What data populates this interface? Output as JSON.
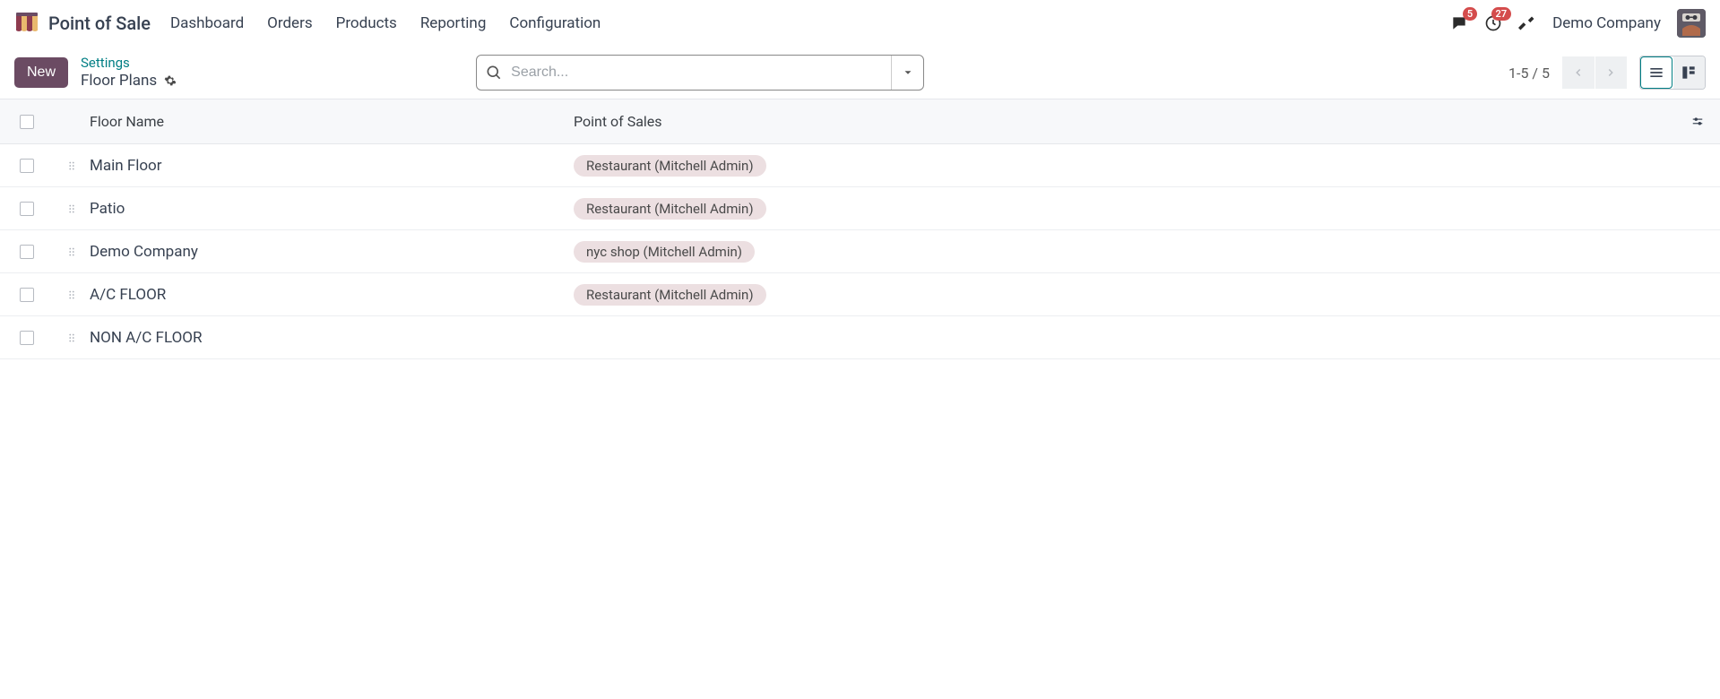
{
  "nav": {
    "app_title": "Point of Sale",
    "menu": [
      "Dashboard",
      "Orders",
      "Products",
      "Reporting",
      "Configuration"
    ],
    "messages_badge": "5",
    "activities_badge": "27",
    "company": "Demo Company"
  },
  "control": {
    "new_label": "New",
    "breadcrumb_parent": "Settings",
    "breadcrumb_current": "Floor Plans",
    "search_placeholder": "Search...",
    "pager": "1-5 / 5"
  },
  "table": {
    "col_floor": "Floor Name",
    "col_pos": "Point of Sales",
    "rows": [
      {
        "name": "Main Floor",
        "pos": "Restaurant (Mitchell Admin)"
      },
      {
        "name": "Patio",
        "pos": "Restaurant (Mitchell Admin)"
      },
      {
        "name": "Demo Company",
        "pos": "nyc shop (Mitchell Admin)"
      },
      {
        "name": "A/C FLOOR",
        "pos": "Restaurant (Mitchell Admin)"
      },
      {
        "name": "NON A/C FLOOR",
        "pos": ""
      }
    ]
  }
}
